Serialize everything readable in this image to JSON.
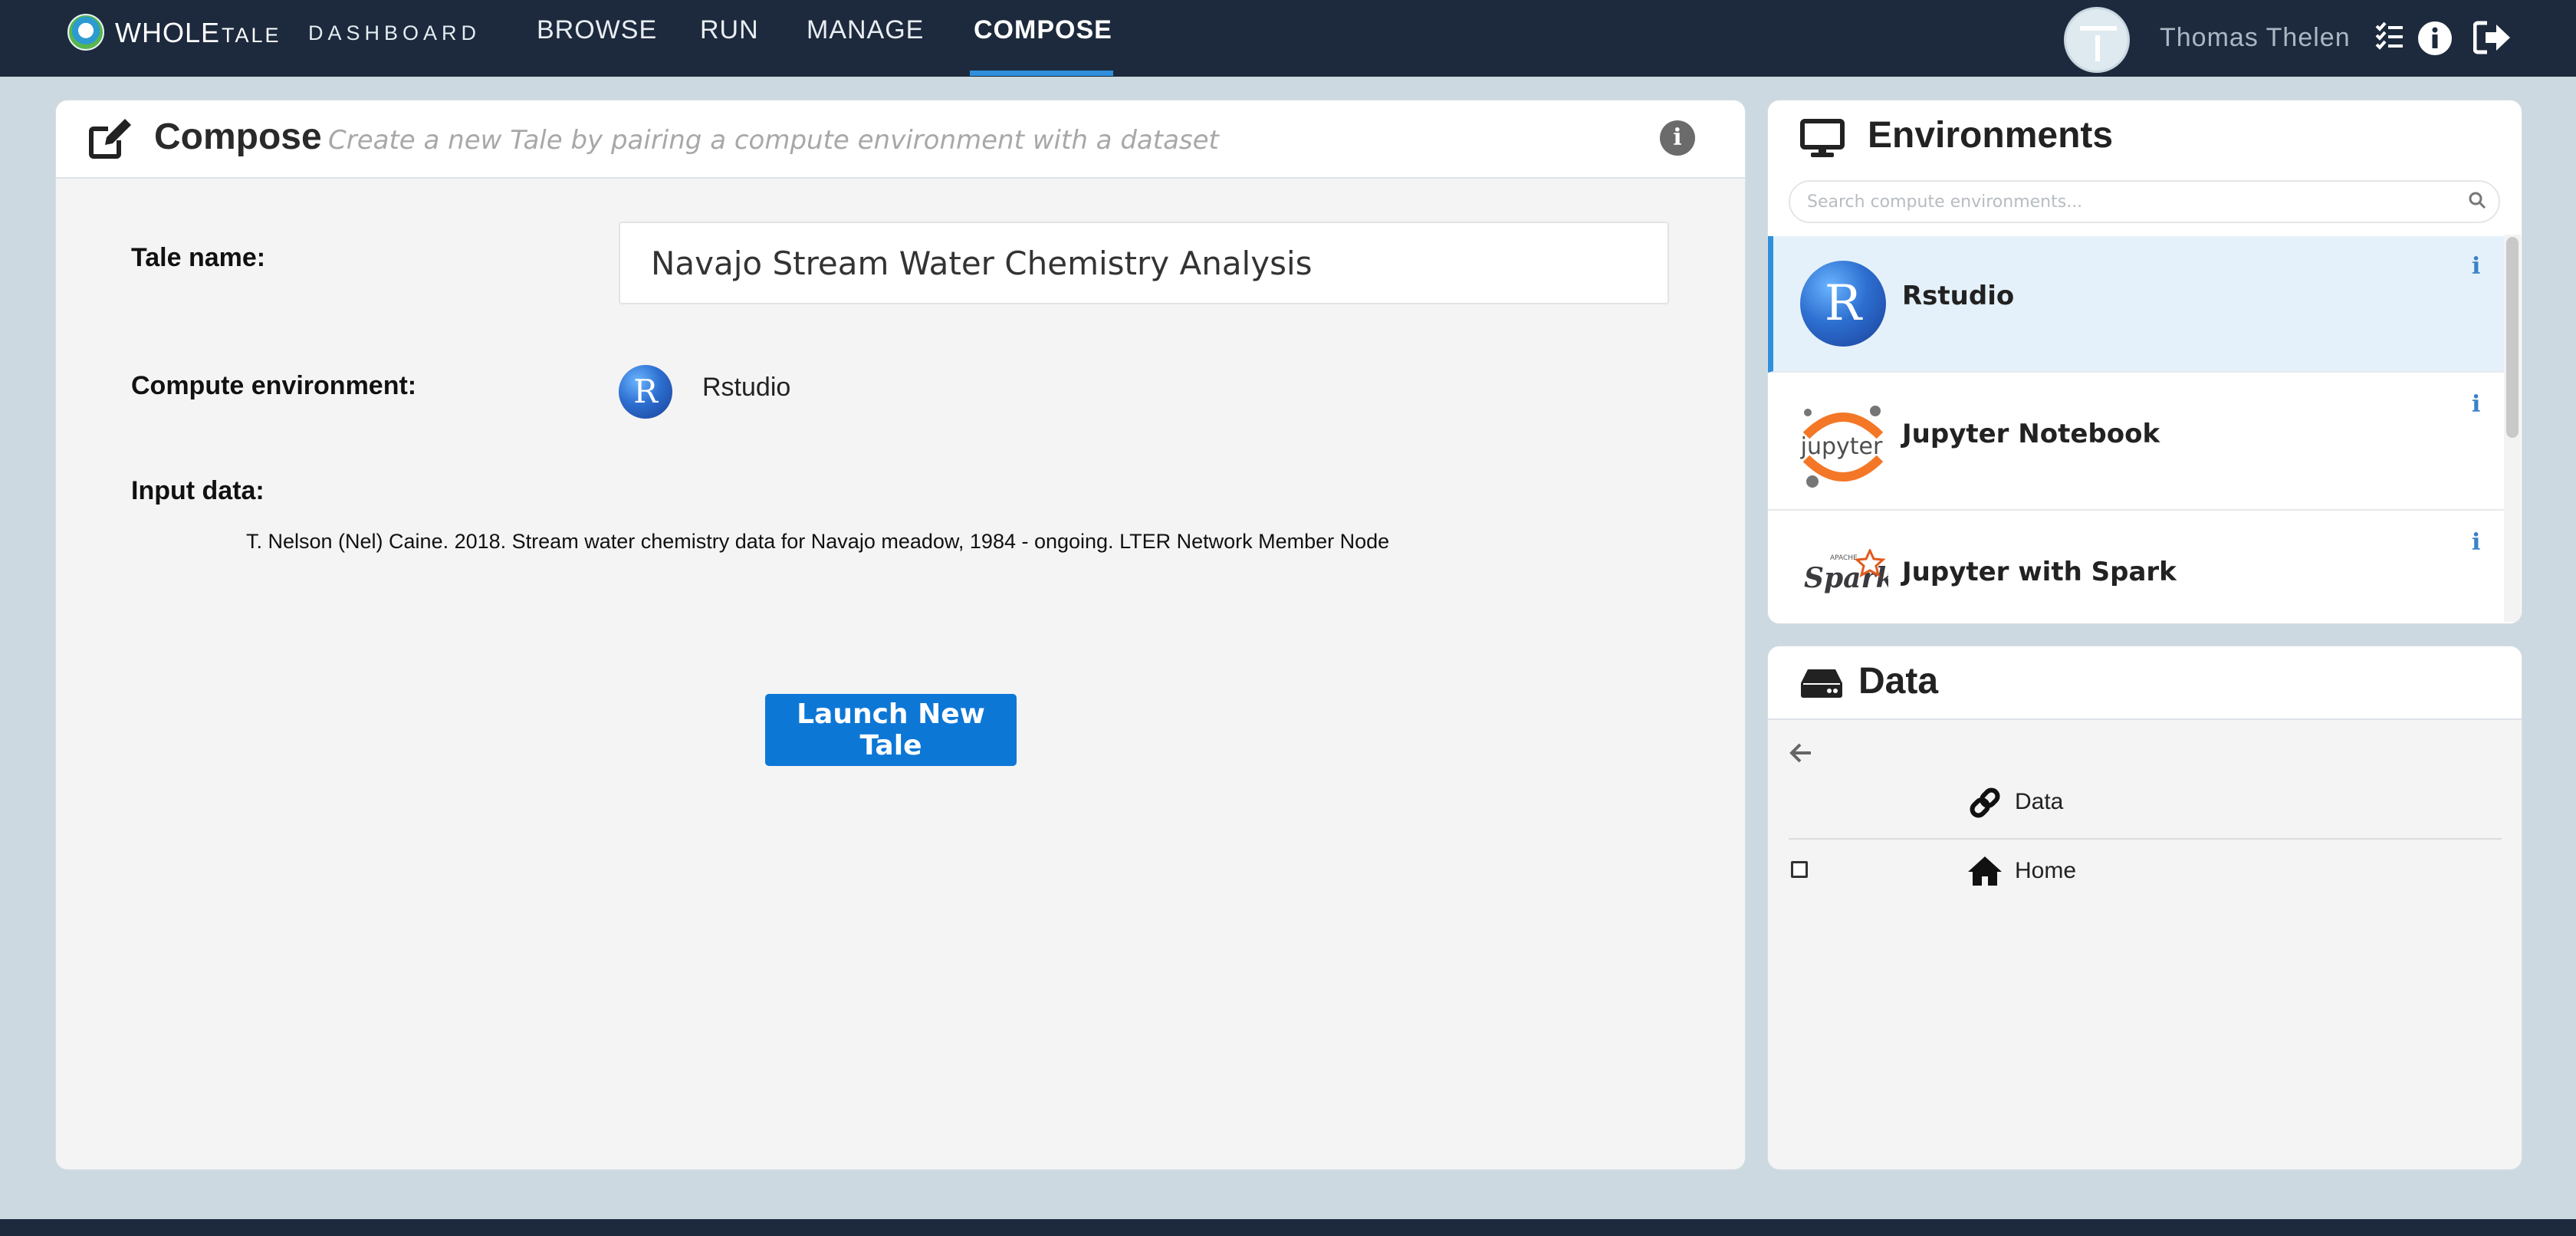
{
  "nav": {
    "brand_main": "WHOLE",
    "brand_tale": "TALE",
    "brand_dashboard": "DASHBOARD",
    "items": [
      {
        "label": "BROWSE"
      },
      {
        "label": "RUN"
      },
      {
        "label": "MANAGE"
      },
      {
        "label": "COMPOSE",
        "active": true
      }
    ],
    "username": "Thomas Thelen"
  },
  "compose": {
    "title": "Compose",
    "subtitle": "Create a new Tale by pairing a compute environment with a dataset",
    "tale_name_label": "Tale name:",
    "tale_name_value": "Navajo Stream Water Chemistry Analysis",
    "compute_env_label": "Compute environment:",
    "compute_env_value": "Rstudio",
    "compute_env_icon_letter": "R",
    "input_data_label": "Input data:",
    "input_data_citation": "T. Nelson (Nel) Caine. 2018. Stream water chemistry data for Navajo meadow, 1984 - ongoing. LTER Network Member Node",
    "launch_button": "Launch New Tale"
  },
  "environments": {
    "title": "Environments",
    "search_placeholder": "Search compute environments...",
    "items": [
      {
        "name": "Rstudio",
        "icon": "rstudio-logo",
        "icon_letter": "R",
        "selected": true
      },
      {
        "name": "Jupyter Notebook",
        "icon": "jupyter-logo",
        "icon_text": "jupyter",
        "selected": false
      },
      {
        "name": "Jupyter with Spark",
        "icon": "spark-logo",
        "icon_text": "Spark",
        "icon_small_text": "APACHE",
        "selected": false
      }
    ]
  },
  "data_panel": {
    "title": "Data",
    "rows": [
      {
        "label": "Data",
        "icon": "link-icon"
      },
      {
        "label": "Home",
        "icon": "home-icon"
      }
    ]
  },
  "colors": {
    "nav_bg": "#1d2a3d",
    "accent": "#2f8fdc",
    "launch_button": "#0d77d6",
    "page_bg": "#ccd9e0",
    "selected_env_bg": "#e5f1fa"
  }
}
